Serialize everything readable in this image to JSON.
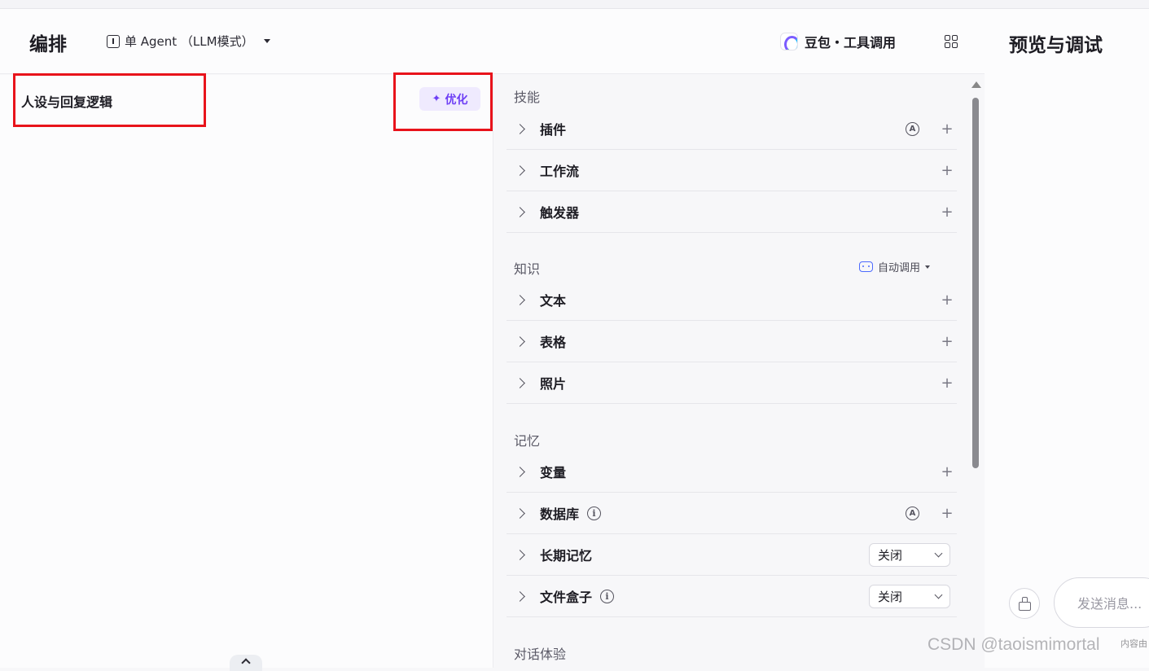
{
  "header": {
    "title": "编排",
    "mode_label": "单 Agent （LLM模式）",
    "model_label": "豆包・工具调用"
  },
  "preview": {
    "title": "预览与调试",
    "input_placeholder": "发送消息...",
    "bottom_note": "内容由"
  },
  "persona": {
    "title": "人设与回复逻辑",
    "optimize_label": "优化"
  },
  "skills": {
    "section_label": "技能",
    "items": [
      {
        "label": "插件",
        "auto": "A",
        "add": "+"
      },
      {
        "label": "工作流",
        "add": "+"
      },
      {
        "label": "触发器",
        "add": "+"
      }
    ]
  },
  "knowledge": {
    "section_label": "知识",
    "auto_call_label": "自动调用",
    "items": [
      {
        "label": "文本",
        "add": "+"
      },
      {
        "label": "表格",
        "add": "+"
      },
      {
        "label": "照片",
        "add": "+"
      }
    ]
  },
  "memory": {
    "section_label": "记忆",
    "items": [
      {
        "label": "变量",
        "add": "+"
      },
      {
        "label": "数据库",
        "info": "i",
        "auto": "A",
        "add": "+"
      },
      {
        "label": "长期记忆",
        "select_value": "关闭"
      },
      {
        "label": "文件盒子",
        "info": "i",
        "select_value": "关闭"
      }
    ]
  },
  "dialog": {
    "section_label": "对话体验"
  },
  "watermark": "CSDN @taoismimortal",
  "colors": {
    "highlight_box": "#e8131b",
    "accent_purple": "#6d3ef5",
    "accent_blue": "#4d6bfe"
  }
}
